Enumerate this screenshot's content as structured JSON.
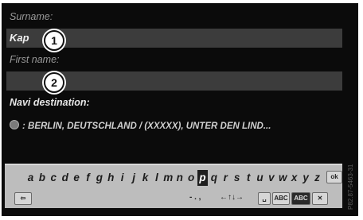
{
  "fields": {
    "surname_label": "Surname:",
    "surname_value": "Kap",
    "first_name_label": "First name:",
    "first_name_value": "",
    "navi_label": "Navi destination:",
    "navi_value": ": BERLIN, DEUTSCHLAND / (XXXXX), UNTER DEN LIND..."
  },
  "callouts": [
    "1",
    "2"
  ],
  "keyboard": {
    "letters": [
      "a",
      "b",
      "c",
      "d",
      "e",
      "f",
      "g",
      "h",
      "i",
      "j",
      "k",
      "l",
      "m",
      "n",
      "o",
      "p",
      "q",
      "r",
      "s",
      "t",
      "u",
      "v",
      "w",
      "x",
      "y",
      "z"
    ],
    "selected_letter": "p",
    "ok_label": "ok",
    "back_label": "⇦",
    "symbols_label": "- . ,",
    "cursor_label": "←↑↓→",
    "space_label": "␣",
    "abc_label": "ABC",
    "special_label": "ABC",
    "delete_label": "✕"
  },
  "watermark": "P82.87-5463-31"
}
